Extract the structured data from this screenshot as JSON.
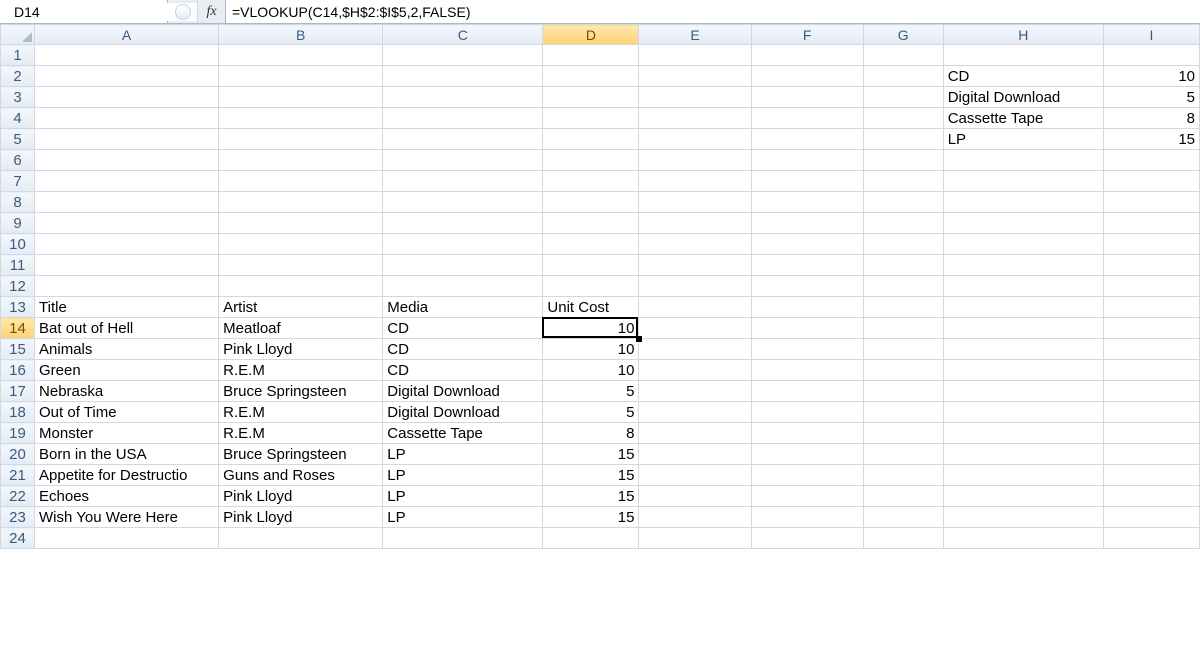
{
  "nameBox": "D14",
  "formula": "=VLOOKUP(C14,$H$2:$I$5,2,FALSE)",
  "fxLabel": "fx",
  "columns": [
    "A",
    "B",
    "C",
    "D",
    "E",
    "F",
    "G",
    "H",
    "I"
  ],
  "activeCol": "D",
  "activeRow": 14,
  "rowCount": 24,
  "lookup": [
    {
      "media": "CD",
      "cost": 10
    },
    {
      "media": "Digital Download",
      "cost": 5
    },
    {
      "media": "Cassette Tape",
      "cost": 8
    },
    {
      "media": "LP",
      "cost": 15
    }
  ],
  "headers": {
    "A": "Title",
    "B": "Artist",
    "C": "Media",
    "D": "Unit Cost"
  },
  "albums": [
    {
      "title": "Bat out of Hell",
      "artist": "Meatloaf",
      "media": "CD",
      "cost": 10
    },
    {
      "title": "Animals",
      "artist": "Pink Lloyd",
      "media": "CD",
      "cost": 10
    },
    {
      "title": "Green",
      "artist": "R.E.M",
      "media": "CD",
      "cost": 10
    },
    {
      "title": "Nebraska",
      "artist": "Bruce Springsteen",
      "media": "Digital Download",
      "cost": 5
    },
    {
      "title": "Out of Time",
      "artist": "R.E.M",
      "media": "Digital Download",
      "cost": 5
    },
    {
      "title": "Monster",
      "artist": "R.E.M",
      "media": "Cassette Tape",
      "cost": 8
    },
    {
      "title": "Born in the USA",
      "artist": "Bruce Springsteen",
      "media": "LP",
      "cost": 15
    },
    {
      "title": "Appetite for Destructio",
      "artist": "Guns and Roses",
      "media": "LP",
      "cost": 15
    },
    {
      "title": "Echoes",
      "artist": "Pink Lloyd",
      "media": "LP",
      "cost": 15
    },
    {
      "title": "Wish You Were Here",
      "artist": "Pink Lloyd",
      "media": "LP",
      "cost": 15
    }
  ],
  "chart_data": {
    "type": "table",
    "title": "",
    "tables": [
      {
        "name": "lookup",
        "columns": [
          "Media",
          "Cost"
        ],
        "rows": [
          [
            "CD",
            10
          ],
          [
            "Digital Download",
            5
          ],
          [
            "Cassette Tape",
            8
          ],
          [
            "LP",
            15
          ]
        ]
      },
      {
        "name": "albums",
        "columns": [
          "Title",
          "Artist",
          "Media",
          "Unit Cost"
        ],
        "rows": [
          [
            "Bat out of Hell",
            "Meatloaf",
            "CD",
            10
          ],
          [
            "Animals",
            "Pink Lloyd",
            "CD",
            10
          ],
          [
            "Green",
            "R.E.M",
            "CD",
            10
          ],
          [
            "Nebraska",
            "Bruce Springsteen",
            "Digital Download",
            5
          ],
          [
            "Out of Time",
            "R.E.M",
            "Digital Download",
            5
          ],
          [
            "Monster",
            "R.E.M",
            "Cassette Tape",
            8
          ],
          [
            "Born in the USA",
            "Bruce Springsteen",
            "LP",
            15
          ],
          [
            "Appetite for Destructio",
            "Guns and Roses",
            "LP",
            15
          ],
          [
            "Echoes",
            "Pink Lloyd",
            "LP",
            15
          ],
          [
            "Wish You Were Here",
            "Pink Lloyd",
            "LP",
            15
          ]
        ]
      }
    ]
  }
}
